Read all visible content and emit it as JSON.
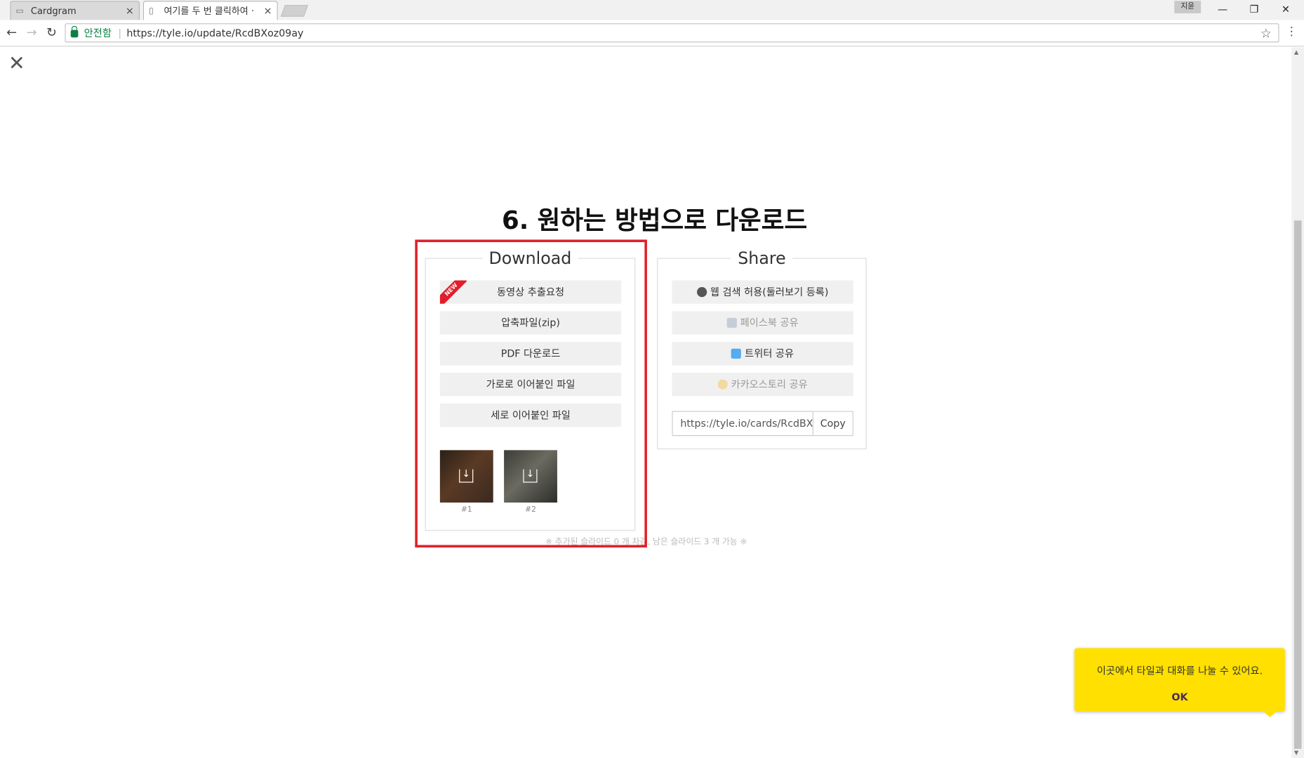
{
  "browser": {
    "tabs": [
      {
        "title": "Cardgram",
        "icon": "chat-icon",
        "close": "×"
      },
      {
        "title": "여기를 두 번 클릭하여 ·",
        "icon": "page-icon",
        "close": "×"
      }
    ],
    "user_badge": "지윤",
    "window": {
      "minimize": "—",
      "restore": "❐",
      "close": "✕"
    },
    "nav": {
      "back": "←",
      "forward": "→",
      "reload": "↻"
    },
    "secure_label": "안전함",
    "url": "https://tyle.io/update/RcdBXoz09ay",
    "star": "☆",
    "menu": "⋮"
  },
  "page": {
    "close": "✕",
    "heading": "6. 원하는 방법으로 다운로드",
    "download": {
      "title": "Download",
      "new_badge": "NEW",
      "buttons": [
        "동영상 추출요청",
        "압축파일(zip)",
        "PDF 다운로드",
        "가로로 이어붙인 파일",
        "세로 이어붙인 파일"
      ],
      "thumbnails": [
        {
          "label": "#1",
          "download_glyph": "↓"
        },
        {
          "label": "#2",
          "download_glyph": "↓"
        }
      ]
    },
    "share": {
      "title": "Share",
      "buttons": [
        {
          "label": "웹 검색 허용(둘러보기 등록)",
          "icon": "globe-icon",
          "color": "#555555"
        },
        {
          "label": "페이스북 공유",
          "icon": "facebook-icon",
          "color": "#c5cdd9"
        },
        {
          "label": "트위터 공유",
          "icon": "twitter-icon",
          "color": "#55acee"
        },
        {
          "label": "카카오스토리 공유",
          "icon": "kakaostory-icon",
          "color": "#f4d9a0"
        }
      ],
      "link_value": "https://tyle.io/cards/RcdBXo",
      "copy_label": "Copy"
    },
    "note": "※ 추가된 슬라이드 0 개 차감, 남은 슬라이드 3 개 가능 ※"
  },
  "toast": {
    "message": "이곳에서 타일과 대화를 나눌 수 있어요.",
    "ok": "OK"
  },
  "colors": {
    "highlight": "#e0202a",
    "toast": "#ffe000",
    "secure": "#0b8043"
  }
}
